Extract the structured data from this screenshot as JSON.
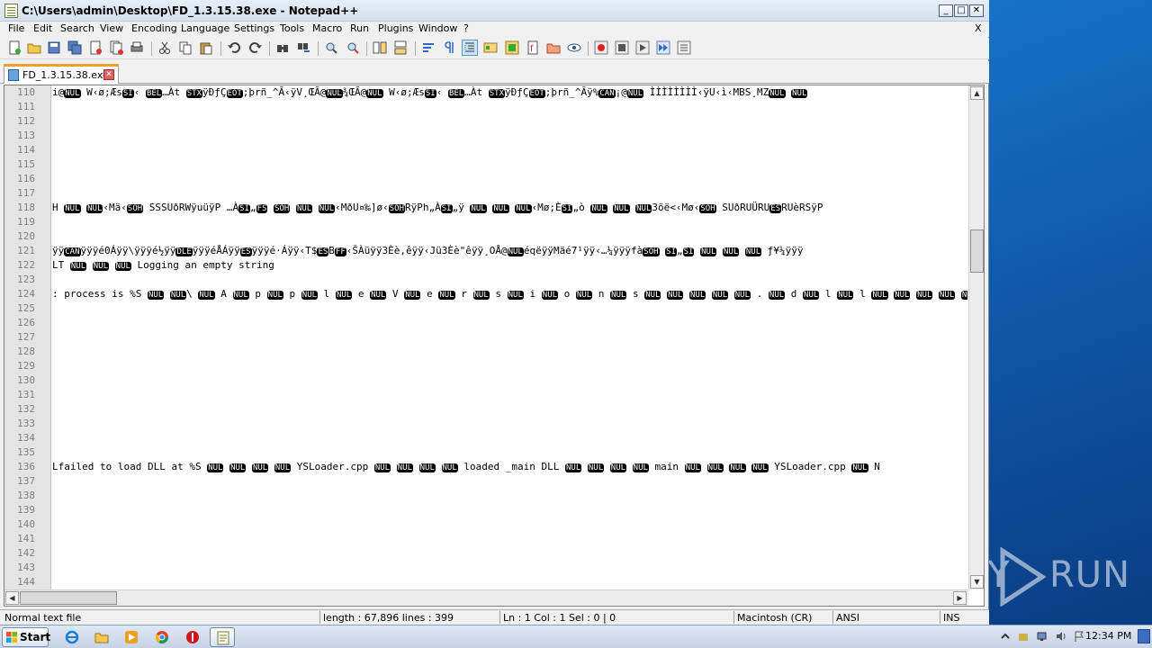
{
  "window": {
    "title": "C:\\Users\\admin\\Desktop\\FD_1.3.15.38.exe - Notepad++",
    "min_label": "_",
    "max_label": "□",
    "close_label": "✕"
  },
  "menu": [
    "File",
    "Edit",
    "Search",
    "View",
    "Encoding",
    "Language",
    "Settings",
    "Tools",
    "Macro",
    "Run",
    "Plugins",
    "Window",
    "?"
  ],
  "menu_close": "X",
  "tab": {
    "label": "FD_1.3.15.38.exe",
    "close": "✕"
  },
  "editor": {
    "line_numbers": [
      "110",
      "111",
      "112",
      "113",
      "114",
      "115",
      "116",
      "117",
      "118",
      "119",
      "120",
      "121",
      "122",
      "123",
      "124",
      "125",
      "126",
      "127",
      "128",
      "129",
      "130",
      "131",
      "132",
      "133",
      "134",
      "135",
      "136",
      "137",
      "138",
      "139",
      "140",
      "141",
      "142",
      "143",
      "144"
    ],
    "lines": {
      "l110": "i@NUL W‹ø;ÆsSI‹ BEL…Àt STXÿÐƒÇEOT;þrñ_^Ã‹ÿV¸ŒÃ@NUL¾ŒÃ@NUL W‹ø;ÆsSI‹ BEL…Àt STXÿÐƒÇEOT;þrñ_^Ãÿ%CAN¡@NUL ÌÌÌÌÌÌÌÌ‹ÿU‹ì‹MBS¸MZNUL NUL",
      "l118": "H NUL NUL‹Mä‹SOH SSSUðRWÿuüÿP …ÀSI„FS SOH NUL NUL‹MðU¤‰]ø‹SOHRÿPh„ÀSI„ÿ NUL NUL NUL‹Mø;ÈSI„ò NUL NUL NUL3öë<‹Mø‹SOH SUðRUÜRUESRUèRSÿP",
      "l121": "ÿÿCANÿÿÿé0Áÿÿ\\ÿÿÿé½ÿÿDLEÿÿÿéÅÁÿÿESÿÿÿé·Áÿÿ‹T$ESBFF‹ŠÀüÿÿ3Èè,êÿÿ‹Jü3Èè\"êÿÿ¸OÅ@NULéqëÿÿMäé7¹ÿÿ‹…¼ÿÿÿfàSOH SI„SI NUL NUL NUL ƒ¥¼ÿÿÿ",
      "l122": "LT NUL NUL NUL Logging an empty string",
      "l124": ": process is %S NUL NUL\\ NUL A NUL p NUL p NUL l NUL e NUL V NUL e NUL r NUL s NUL i NUL o NUL n NUL s NUL NUL NUL NUL NUL . NUL d NUL l NUL l NUL NUL NUL NUL NUL",
      "l136": "Lfailed to load DLL at %S NUL NUL NUL NUL YSLoader.cpp NUL NUL NUL NUL loaded _main DLL NUL NUL NUL NUL main NUL NUL NUL NUL YSLoader.cpp NUL N"
    },
    "scroll_up": "▲",
    "scroll_down": "▼",
    "scroll_left": "◀",
    "scroll_right": "▶"
  },
  "status": {
    "type": "Normal text file",
    "length": "length : 67,896    lines : 399",
    "position": "Ln : 1    Col : 1    Sel : 0 | 0",
    "eol": "Macintosh (CR)",
    "encoding": "ANSI",
    "mode": "INS"
  },
  "taskbar": {
    "start_label": "Start",
    "clock": "12:34 PM"
  },
  "watermark": {
    "left": "ANY",
    "right": "RUN"
  },
  "icons": [
    "new-file-icon",
    "open-icon",
    "save-icon",
    "save-all-icon",
    "close-icon",
    "close-all-icon",
    "print-icon",
    "cut-icon",
    "copy-icon",
    "paste-icon",
    "undo-icon",
    "redo-icon",
    "find-icon",
    "replace-icon",
    "zoom-in-icon",
    "zoom-out-icon",
    "sync-v-icon",
    "sync-h-icon",
    "word-wrap-icon",
    "all-chars-icon",
    "indent-guide-icon",
    "udl-icon",
    "doc-map-icon",
    "function-list-icon",
    "folder-workspace-icon",
    "monitor-icon",
    "record-macro-icon",
    "stop-macro-icon",
    "play-macro-icon",
    "run-macro-multiple-icon",
    "save-macro-icon"
  ],
  "colors": {
    "desktop": "#1672c8",
    "tab_accent": "#f0a030",
    "gutter": "#e4e4e4"
  }
}
